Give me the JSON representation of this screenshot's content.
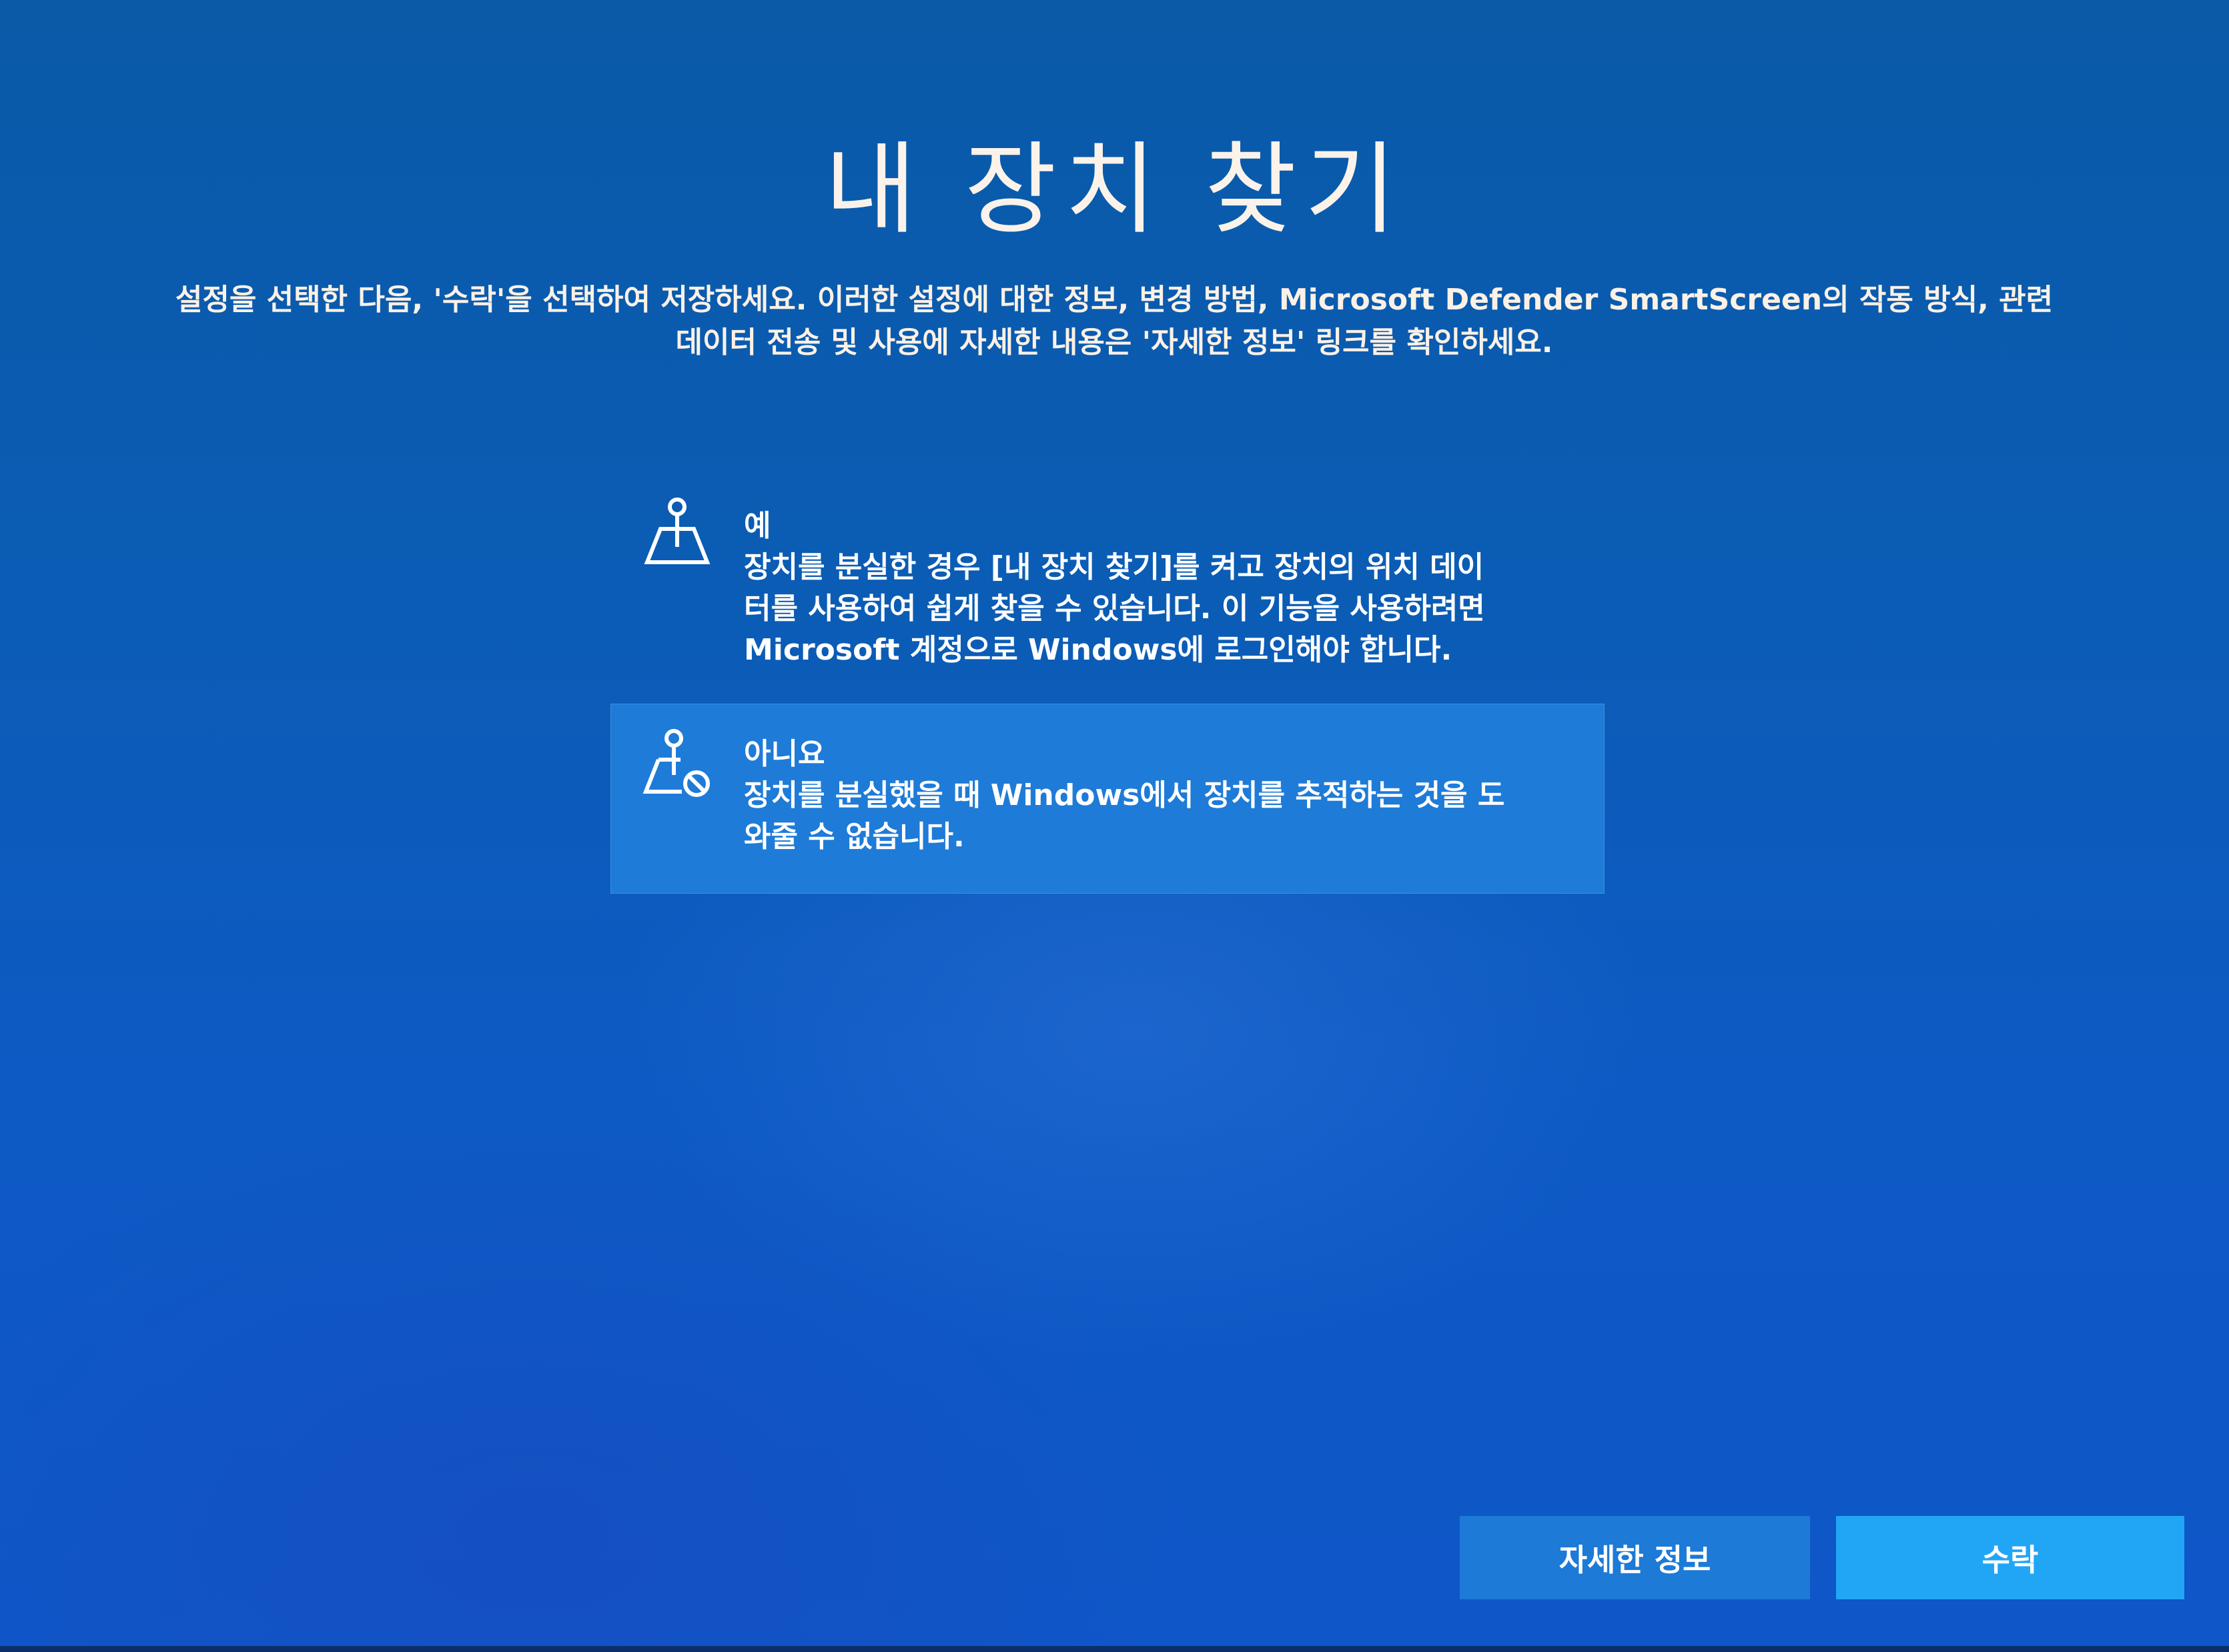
{
  "page": {
    "title": "내 장치 찾기",
    "subtitle": "설정을 선택한 다음, '수락'을 선택하여 저장하세요. 이러한 설정에 대한 정보, 변경 방법, Microsoft Defender SmartScreen의 작동 방식, 관련\n데이터 전송 및 사용에 자세한 내용은 '자세한 정보' 링크를 확인하세요."
  },
  "options": [
    {
      "label": "예",
      "description": "장치를 분실한 경우 [내 장치 찾기]를 켜고 장치의 위치 데이\n터를 사용하여 쉽게 찾을 수 있습니다. 이 기능을 사용하려면\nMicrosoft 계정으로 Windows에 로그인해야 합니다.",
      "icon": "location-pin-map-icon",
      "selected": false
    },
    {
      "label": "아니요",
      "description": "장치를 분실했을 때 Windows에서 장치를 추적하는 것을 도\n와줄 수 없습니다.",
      "icon": "location-pin-blocked-icon",
      "selected": true
    }
  ],
  "buttons": {
    "learn_more": "자세한 정보",
    "accept": "수락"
  },
  "colors": {
    "background": "#0b5cb4",
    "selected_option": "#1e7bd8",
    "learn_more_button": "#1d7ad6",
    "accept_button": "#21a6f5"
  }
}
